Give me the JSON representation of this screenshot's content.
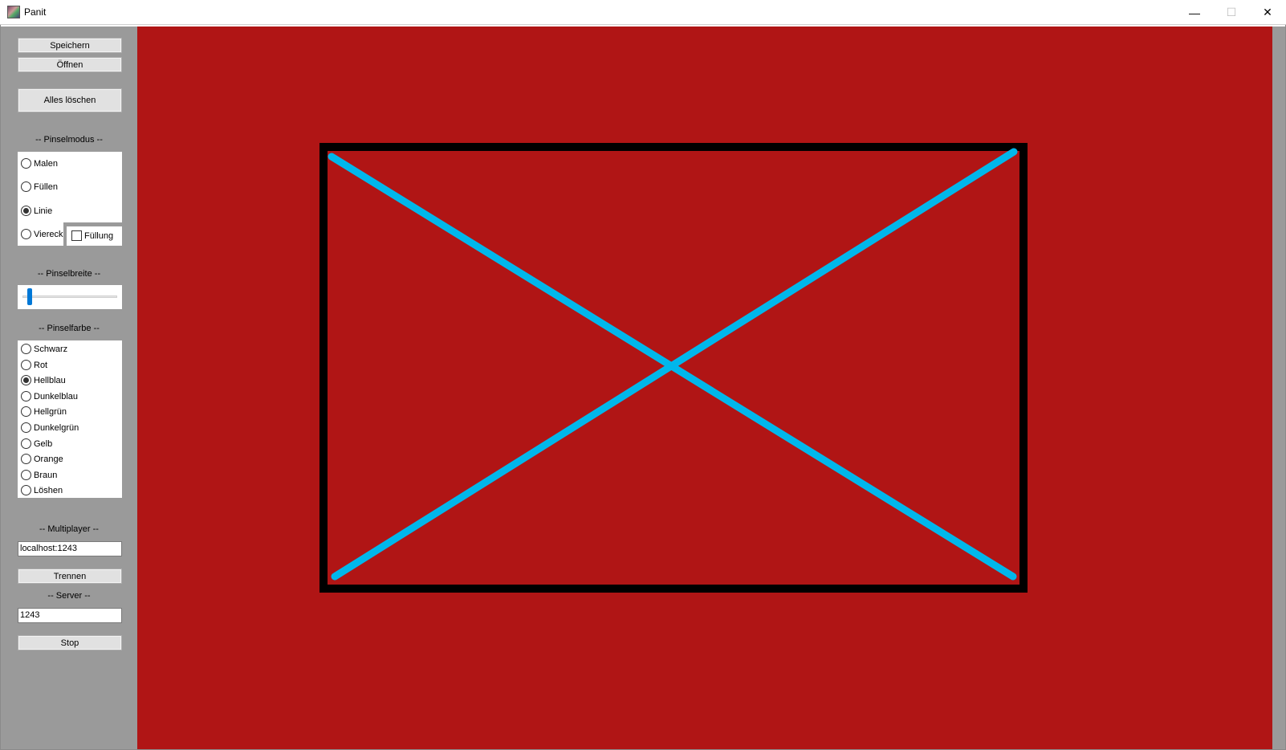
{
  "window": {
    "title": "Panit",
    "minimize_glyph": "—",
    "maximize_glyph": "☐",
    "close_glyph": "✕"
  },
  "toolbar": {
    "save_label": "Speichern",
    "open_label": "Öffnen",
    "clear_all_label": "Alles löschen"
  },
  "brush_mode": {
    "heading": "-- Pinselmodus --",
    "options": [
      {
        "label": "Malen",
        "selected": false
      },
      {
        "label": "Füllen",
        "selected": false
      },
      {
        "label": "Linie",
        "selected": true
      },
      {
        "label": "Viereck",
        "selected": false
      }
    ],
    "fill_checkbox_label": "Füllung",
    "fill_checked": false
  },
  "brush_width": {
    "heading": "-- Pinselbreite --",
    "value_fraction": 0.08
  },
  "brush_color": {
    "heading": "-- Pinselfarbe --",
    "options": [
      {
        "label": "Schwarz",
        "selected": false
      },
      {
        "label": "Rot",
        "selected": false
      },
      {
        "label": "Hellblau",
        "selected": true
      },
      {
        "label": "Dunkelblau",
        "selected": false
      },
      {
        "label": "Hellgrün",
        "selected": false
      },
      {
        "label": "Dunkelgrün",
        "selected": false
      },
      {
        "label": "Gelb",
        "selected": false
      },
      {
        "label": "Orange",
        "selected": false
      },
      {
        "label": "Braun",
        "selected": false
      },
      {
        "label": "Löshen",
        "selected": false
      }
    ]
  },
  "multiplayer": {
    "heading": "-- Multiplayer --",
    "address_value": "localhost:1243",
    "disconnect_label": "Trennen"
  },
  "server": {
    "heading": "-- Server --",
    "port_value": "1243",
    "stop_label": "Stop"
  },
  "colors": {
    "canvas_background": "#b01515",
    "rectangle_stroke": "#000000",
    "line_stroke": "#00b7eb",
    "sidebar_background": "#9a9a9a"
  }
}
